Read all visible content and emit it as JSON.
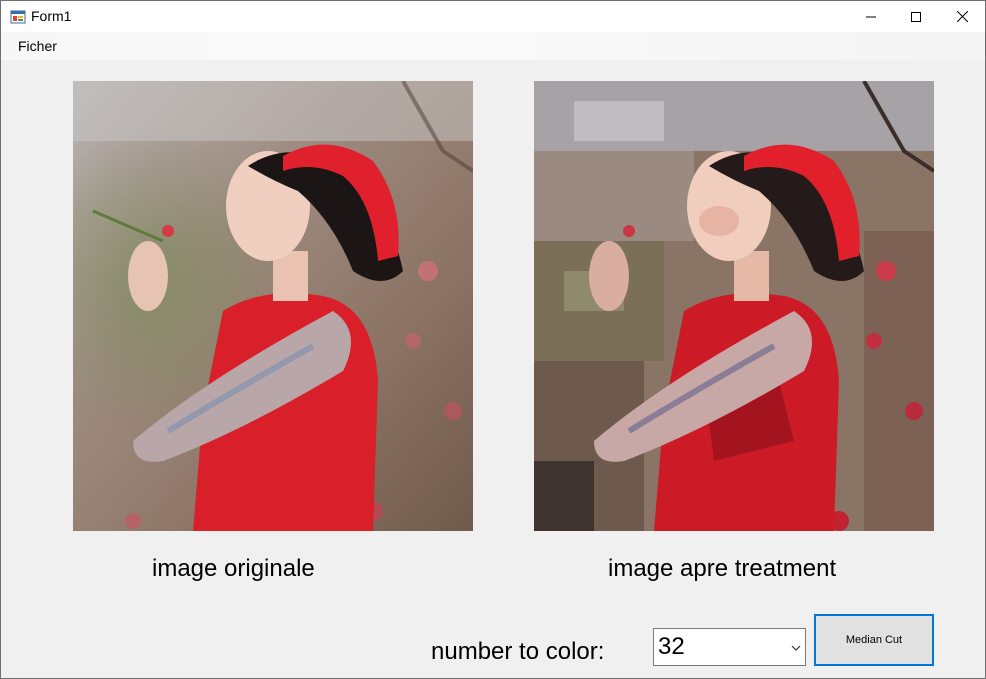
{
  "window": {
    "title": "Form1",
    "icons": {
      "app": "form-app-icon",
      "minimize": "minimize-icon",
      "maximize": "maximize-icon",
      "close": "close-icon"
    }
  },
  "menu": {
    "items": [
      "Ficher"
    ]
  },
  "images": {
    "original_caption": "image originale",
    "processed_caption": "image apre treatment"
  },
  "controls": {
    "number_label": "number to color:",
    "color_count_value": "32",
    "median_cut_label": "Median Cut"
  },
  "colors": {
    "accent": "#0078d7",
    "background": "#f0f0f0",
    "dress_red": "#d81f2a"
  }
}
